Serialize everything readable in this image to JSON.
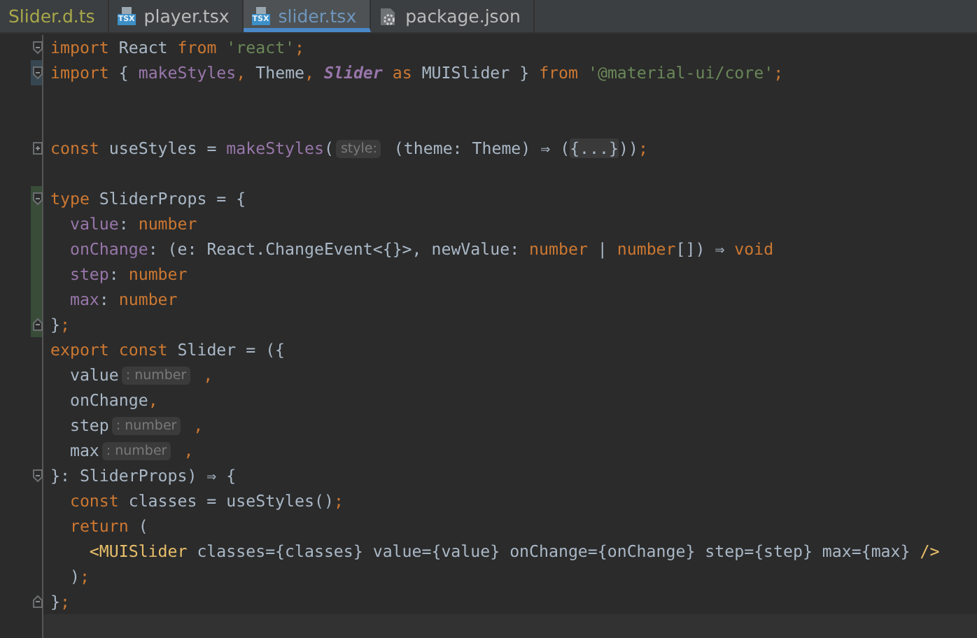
{
  "tabs": [
    {
      "label": "Slider.d.ts",
      "selected": false,
      "kind": "plain",
      "color": "#a8a84a"
    },
    {
      "label": "player.tsx",
      "selected": false,
      "kind": "tsx",
      "badge": "TSX",
      "color": "#bbbbbb"
    },
    {
      "label": "slider.tsx",
      "selected": true,
      "kind": "tsx",
      "badge": "TSX",
      "color": "#6e96be"
    },
    {
      "label": "package.json",
      "selected": false,
      "kind": "config",
      "color": "#bbbbbb"
    }
  ],
  "editor": {
    "lines": [
      {
        "kind": "code",
        "fold_start": true,
        "tokens": [
          {
            "kind": "kw",
            "text": "import "
          },
          {
            "kind": "plain",
            "text": "React "
          },
          {
            "kind": "kw",
            "text": "from "
          },
          {
            "kind": "str",
            "text": "'react'"
          },
          {
            "kind": "kw",
            "text": ";"
          }
        ]
      },
      {
        "kind": "code",
        "fold_start": true,
        "modified": true,
        "tokens": [
          {
            "kind": "kw",
            "text": "import "
          },
          {
            "kind": "plain",
            "text": "{ "
          },
          {
            "kind": "fn",
            "text": "makeStyles"
          },
          {
            "kind": "kw",
            "text": ", "
          },
          {
            "kind": "plain",
            "text": "Theme"
          },
          {
            "kind": "kw",
            "text": ", "
          },
          {
            "kind": "italic",
            "text": "Slider"
          },
          {
            "kind": "kw",
            "text": " as "
          },
          {
            "kind": "plain",
            "text": "MUISlider } "
          },
          {
            "kind": "kw",
            "text": "from "
          },
          {
            "kind": "str",
            "text": "'@material-ui/core'"
          },
          {
            "kind": "kw",
            "text": ";"
          }
        ]
      },
      {
        "kind": "blank"
      },
      {
        "kind": "blank"
      },
      {
        "kind": "code",
        "folded": true,
        "tokens": [
          {
            "kind": "kw",
            "text": "const "
          },
          {
            "kind": "plain",
            "text": "useStyles = "
          },
          {
            "kind": "fn",
            "text": "makeStyles"
          },
          {
            "kind": "plain",
            "text": "("
          },
          {
            "kind": "hint",
            "text": "style:"
          },
          {
            "kind": "plain",
            "text": " (theme: Theme) ⇒ ("
          },
          {
            "kind": "folded",
            "text": "{...}"
          },
          {
            "kind": "plain",
            "text": ")"
          },
          {
            "kind": "plain",
            "text": ")"
          },
          {
            "kind": "kw",
            "text": ";"
          }
        ]
      },
      {
        "kind": "blank"
      },
      {
        "kind": "code",
        "fold_start": true,
        "added": true,
        "tokens": [
          {
            "kind": "kw",
            "text": "type "
          },
          {
            "kind": "plain",
            "text": "SliderProps = {"
          }
        ]
      },
      {
        "kind": "code",
        "added": true,
        "tokens": [
          {
            "kind": "fn",
            "text": "  value"
          },
          {
            "kind": "plain",
            "text": ": "
          },
          {
            "kind": "kw",
            "text": "number"
          }
        ]
      },
      {
        "kind": "code",
        "added": true,
        "tokens": [
          {
            "kind": "fn",
            "text": "  onChange"
          },
          {
            "kind": "plain",
            "text": ": (e: React.ChangeEvent<{}>, newValue: "
          },
          {
            "kind": "kw",
            "text": "number"
          },
          {
            "kind": "plain",
            "text": " | "
          },
          {
            "kind": "kw",
            "text": "number"
          },
          {
            "kind": "plain",
            "text": "[]) ⇒ "
          },
          {
            "kind": "kw",
            "text": "void"
          }
        ]
      },
      {
        "kind": "code",
        "added": true,
        "tokens": [
          {
            "kind": "fn",
            "text": "  step"
          },
          {
            "kind": "plain",
            "text": ": "
          },
          {
            "kind": "kw",
            "text": "number"
          }
        ]
      },
      {
        "kind": "code",
        "added": true,
        "tokens": [
          {
            "kind": "fn",
            "text": "  max"
          },
          {
            "kind": "plain",
            "text": ": "
          },
          {
            "kind": "kw",
            "text": "number"
          }
        ]
      },
      {
        "kind": "code",
        "fold_end": true,
        "added": true,
        "tokens": [
          {
            "kind": "plain",
            "text": "}"
          },
          {
            "kind": "kw",
            "text": ";"
          }
        ]
      },
      {
        "kind": "code",
        "tokens": [
          {
            "kind": "kw",
            "text": "export const "
          },
          {
            "kind": "plain",
            "text": "Slider = ({"
          }
        ]
      },
      {
        "kind": "code",
        "tokens": [
          {
            "kind": "plain",
            "text": "  value"
          },
          {
            "kind": "hint",
            "text": ": number"
          },
          {
            "kind": "kw",
            "text": " ,"
          }
        ]
      },
      {
        "kind": "code",
        "tokens": [
          {
            "kind": "plain",
            "text": "  onChange"
          },
          {
            "kind": "kw",
            "text": ","
          }
        ]
      },
      {
        "kind": "code",
        "tokens": [
          {
            "kind": "plain",
            "text": "  step"
          },
          {
            "kind": "hint",
            "text": ": number"
          },
          {
            "kind": "kw",
            "text": " ,"
          }
        ]
      },
      {
        "kind": "code",
        "tokens": [
          {
            "kind": "plain",
            "text": "  max"
          },
          {
            "kind": "hint",
            "text": ": number"
          },
          {
            "kind": "kw",
            "text": " ,"
          }
        ]
      },
      {
        "kind": "code",
        "fold_start": true,
        "tokens": [
          {
            "kind": "plain",
            "text": "}: SliderProps) ⇒ {"
          }
        ]
      },
      {
        "kind": "code",
        "tokens": [
          {
            "kind": "kw",
            "text": "  const "
          },
          {
            "kind": "plain",
            "text": "classes = useStyles()"
          },
          {
            "kind": "kw",
            "text": ";"
          }
        ]
      },
      {
        "kind": "code",
        "tokens": [
          {
            "kind": "kw",
            "text": "  return "
          },
          {
            "kind": "plain",
            "text": "("
          }
        ]
      },
      {
        "kind": "code",
        "tokens": [
          {
            "kind": "tag",
            "text": "    <MUISlider "
          },
          {
            "kind": "plain",
            "text": "classes={classes} value={value} onChange={onChange} step={step} max={max} "
          },
          {
            "kind": "tag",
            "text": "/>"
          }
        ]
      },
      {
        "kind": "code",
        "tokens": [
          {
            "kind": "plain",
            "text": "  )"
          },
          {
            "kind": "kw",
            "text": ";"
          }
        ]
      },
      {
        "kind": "code",
        "fold_end": true,
        "tokens": [
          {
            "kind": "plain",
            "text": "}"
          },
          {
            "kind": "kw",
            "text": ";"
          }
        ]
      },
      {
        "kind": "blank",
        "current": true
      }
    ]
  }
}
